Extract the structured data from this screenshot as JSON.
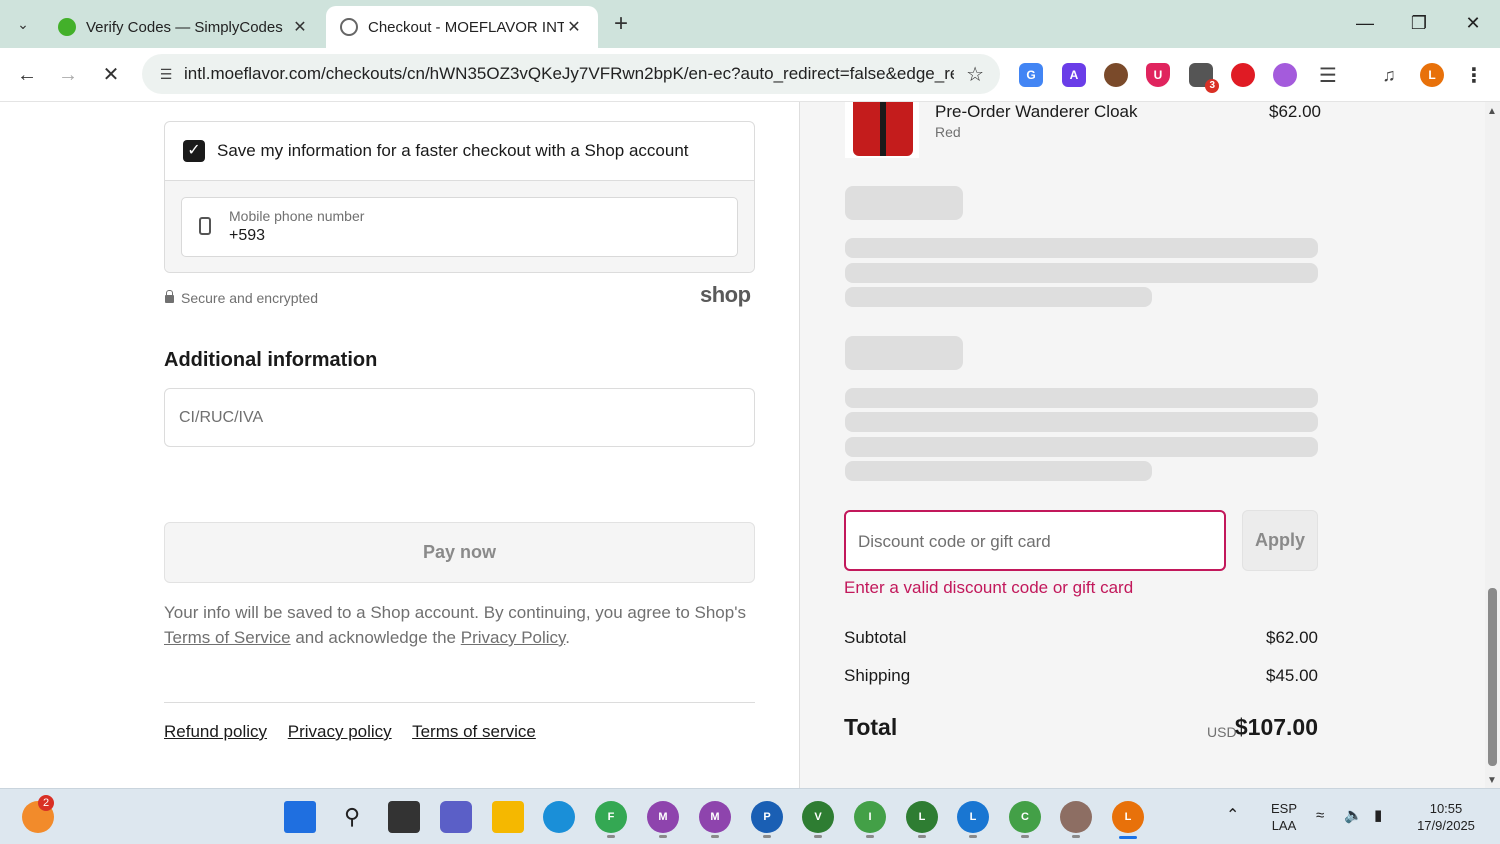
{
  "browser": {
    "tabs": [
      {
        "title": "Verify Codes — SimplyCodes",
        "active": false
      },
      {
        "title": "Checkout - MOEFLAVOR INTL",
        "active": true
      }
    ],
    "url": "intl.moeflavor.com/checkouts/cn/hWN35OZ3vQKeJy7VFRwn2bpK/en-ec?auto_redirect=false&edge_red...",
    "extensions": [
      {
        "icon": "google-translate-icon",
        "color": "#4285f4"
      },
      {
        "icon": "a-extension-icon",
        "color": "#6a3de8"
      },
      {
        "icon": "cookie-icon",
        "color": "#7a4a2a"
      },
      {
        "icon": "shield-u-icon",
        "color": "#e0245e",
        "label": "U"
      },
      {
        "icon": "tab-manager-icon",
        "color": "#555555",
        "badge": "3"
      },
      {
        "icon": "stop-icon",
        "color": "#e01b24"
      },
      {
        "icon": "vpn-icon",
        "color": "#a45bdc"
      },
      {
        "icon": "puzzle-icon",
        "color": "#444444"
      },
      {
        "icon": "media-icon",
        "color": "#444444"
      },
      {
        "icon": "profile-avatar",
        "color": "#e8710a",
        "label": "L"
      }
    ]
  },
  "left": {
    "save_label": "Save my information for a faster checkout with a Shop account",
    "phone_label": "Mobile phone number",
    "phone_value": "+593",
    "secure_text": "Secure and encrypted",
    "shop_logo": "shop",
    "additional_title": "Additional information",
    "tax_id_placeholder": "CI/RUC/IVA",
    "pay_button": "Pay now",
    "legal_part1": "Your info will be saved to a Shop account. By continuing, you agree to Shop's",
    "legal_terms_link": "Terms of Service",
    "legal_part2": "and acknowledge the",
    "legal_privacy_link": "Privacy Policy",
    "legal_end": ".",
    "footer_links": [
      "Refund policy",
      "Privacy policy",
      "Terms of service"
    ]
  },
  "right": {
    "product": {
      "name": "Pre-Order Wanderer Cloak",
      "variant": "Red",
      "price": "$62.00"
    },
    "discount_placeholder": "Discount code or gift card",
    "apply_button": "Apply",
    "error": "Enter a valid discount code or gift card",
    "subtotal_label": "Subtotal",
    "subtotal_value": "$62.00",
    "shipping_label": "Shipping",
    "shipping_value": "$45.00",
    "total_label": "Total",
    "total_currency": "USD",
    "total_value": "$107.00",
    "accent_color": "#c2185b"
  },
  "taskbar": {
    "notification_badge": "2",
    "language": "ESP",
    "layout": "LAA",
    "time": "10:55",
    "date": "17/9/2025"
  }
}
